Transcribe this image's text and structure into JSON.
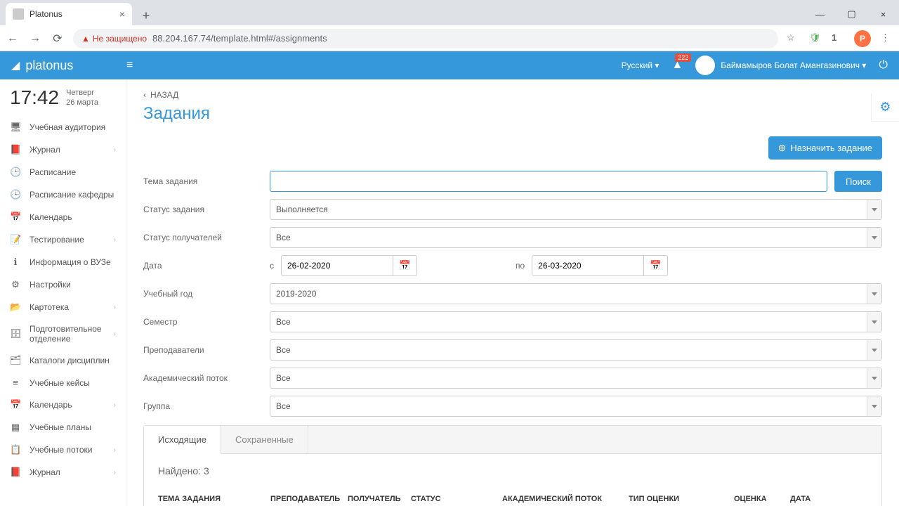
{
  "browser": {
    "tab_title": "Platonus",
    "insecure_label": "Не защищено",
    "url": "88.204.167.74/template.html#/assignments",
    "avatar_letter": "P"
  },
  "header": {
    "logo": "platonus",
    "language": "Русский ▾",
    "notif_count": "222",
    "user_name": "Баймамыров Болат Амангазинович ▾"
  },
  "clock": {
    "time": "17:42",
    "weekday": "Четверг",
    "date": "26 марта"
  },
  "sidebar": {
    "items": [
      {
        "icon": "🖥",
        "label": "Учебная аудитория",
        "caret": false
      },
      {
        "icon": "📕",
        "label": "Журнал",
        "caret": true
      },
      {
        "icon": "🕒",
        "label": "Расписание",
        "caret": false
      },
      {
        "icon": "🕒",
        "label": "Расписание кафедры",
        "caret": false
      },
      {
        "icon": "📅",
        "label": "Календарь",
        "caret": false
      },
      {
        "icon": "📝",
        "label": "Тестирование",
        "caret": true
      },
      {
        "icon": "ℹ",
        "label": "Информация о ВУЗе",
        "caret": false
      },
      {
        "icon": "⚙",
        "label": "Настройки",
        "caret": false
      },
      {
        "icon": "📂",
        "label": "Картотека",
        "caret": true
      },
      {
        "icon": "🗄",
        "label": "Подготовительное отделение",
        "caret": true
      },
      {
        "icon": "🗂",
        "label": "Каталоги дисциплин",
        "caret": false
      },
      {
        "icon": "≡",
        "label": "Учебные кейсы",
        "caret": false
      },
      {
        "icon": "📅",
        "label": "Календарь",
        "caret": true
      },
      {
        "icon": "▦",
        "label": "Учебные планы",
        "caret": false
      },
      {
        "icon": "📋",
        "label": "Учебные потоки",
        "caret": true
      },
      {
        "icon": "📕",
        "label": "Журнал",
        "caret": true
      }
    ]
  },
  "page": {
    "back": "НАЗАД",
    "title": "Задания",
    "assign_btn": "Назначить задание"
  },
  "filters": {
    "topic": {
      "label": "Тема задания",
      "value": ""
    },
    "search_btn": "Поиск",
    "status": {
      "label": "Статус задания",
      "value": "Выполняется"
    },
    "recipient_status": {
      "label": "Статус получателей",
      "value": "Все"
    },
    "date": {
      "label": "Дата",
      "from_lbl": "с",
      "from": "26-02-2020",
      "to_lbl": "по",
      "to": "26-03-2020"
    },
    "year": {
      "label": "Учебный год",
      "value": "2019-2020"
    },
    "semester": {
      "label": "Семестр",
      "value": "Все"
    },
    "teachers": {
      "label": "Преподаватели",
      "value": "Все"
    },
    "stream": {
      "label": "Академический поток",
      "value": "Все"
    },
    "group": {
      "label": "Группа",
      "value": "Все"
    }
  },
  "tabs": {
    "outgoing": "Исходящие",
    "saved": "Сохраненные"
  },
  "results": {
    "found": "Найдено: 3",
    "cols": {
      "topic": "ТЕМА ЗАДАНИЯ",
      "teacher": "ПРЕПОДАВАТЕЛЬ",
      "recipient": "ПОЛУЧАТЕЛЬ",
      "status": "СТАТУС",
      "stream": "АКАДЕМИЧЕСКИЙ ПОТОК",
      "grade_type": "ТИП ОЦЕНКИ",
      "grade": "ОЦЕНКА",
      "date": "ДАТА"
    }
  }
}
